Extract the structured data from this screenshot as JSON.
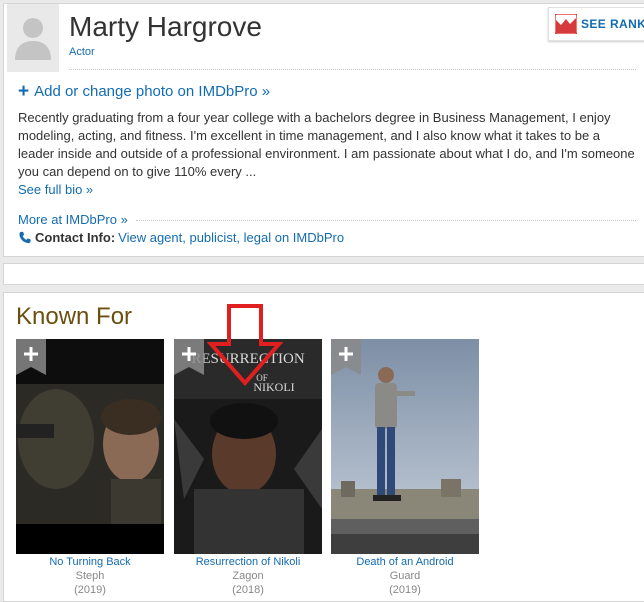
{
  "profile": {
    "name": "Marty Hargrove",
    "role": "Actor",
    "see_rank_label": "SEE RANK",
    "add_photo_label": "Add or change photo on IMDbPro »",
    "bio": "Recently graduating from a four year college with a bachelors degree in Business Management, I enjoy modeling, acting, and fitness. I'm excellent in time management, and I also know what it takes to be a leader inside and outside of a professional environment. I am passionate about what I do, and I'm someone you can depend on to give 110% every ...",
    "see_full_bio_label": "See full bio »",
    "more_imdbpro_label": "More at IMDbPro »",
    "contact_label": "Contact Info:",
    "contact_link": "View agent, publicist, legal on IMDbPro"
  },
  "known_for": {
    "title": "Known For",
    "films": [
      {
        "title": "No Turning Back",
        "role": "Steph",
        "year": "(2019)"
      },
      {
        "title": "Resurrection of Nikoli",
        "role": "Zagon",
        "year": "(2018)"
      },
      {
        "title": "Death of an Android",
        "role": "Guard",
        "year": "(2019)"
      }
    ],
    "poster_2_text": {
      "line1": "RESURRECTION",
      "line2": "OF",
      "line3": "NIKOLI"
    }
  },
  "colors": {
    "link": "#136cb2",
    "known_for_title": "#6b4f10",
    "annotation_arrow": "#e02020",
    "page_bg": "#eaeaea"
  },
  "icons": [
    "person-silhouette-icon",
    "rank-chart-icon",
    "plus-icon",
    "phone-icon",
    "watchlist-plus-icon"
  ]
}
